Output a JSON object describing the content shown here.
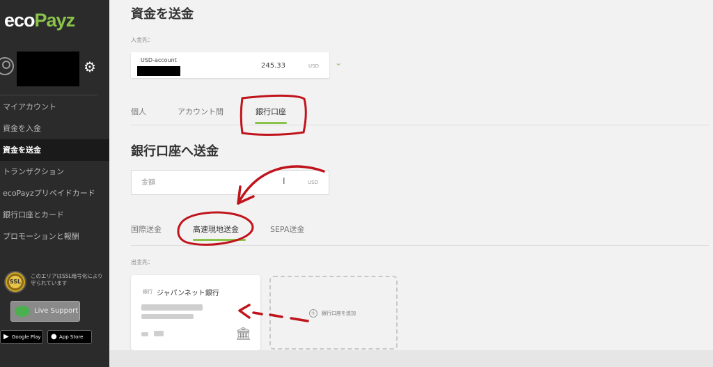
{
  "brand": {
    "logo_eco": "eco",
    "logo_payz": "Payz"
  },
  "sidebar": {
    "items": [
      {
        "label": "マイアカウント"
      },
      {
        "label": "資金を入金"
      },
      {
        "label": "資金を送金"
      },
      {
        "label": "トランザクション"
      },
      {
        "label": "ecoPayzプリペイドカード"
      },
      {
        "label": "銀行口座とカード"
      },
      {
        "label": "プロモーションと報酬"
      }
    ],
    "active_index": 2,
    "ssl_badge": "SSL",
    "ssl_text": "このエリアはSSL暗号化により守られています",
    "live_support": "Live Support",
    "google_play": "Google Play",
    "app_store": "App Store"
  },
  "main": {
    "title": "資金を送金",
    "deposit_label": "入金先：",
    "account": {
      "name": "USD-account",
      "balance": "245.33",
      "currency": "USD"
    },
    "tabs": [
      {
        "label": "個人"
      },
      {
        "label": "アカウント間"
      },
      {
        "label": "銀行口座"
      }
    ],
    "section_title": "銀行口座へ送金",
    "amount": {
      "placeholder": "金額",
      "value": "",
      "currency": "USD"
    },
    "transfer_tabs": [
      {
        "label": "国際送金"
      },
      {
        "label": "高速現地送金"
      },
      {
        "label": "SEPA送金"
      }
    ],
    "from_label": "出金先：",
    "bank_card": {
      "type": "銀行",
      "name": "ジャパンネット銀行"
    },
    "add_bank_label": "銀行口座を追加"
  },
  "colors": {
    "accent": "#8bc34a",
    "sidebar_bg": "#2b2b2b",
    "annotation": "#c0141c"
  },
  "icons": [
    "user-avatar-icon",
    "gear-icon",
    "chevron-down-icon",
    "text-cursor-icon",
    "bank-building-icon",
    "plus-circle-icon",
    "chat-bubble-icon",
    "google-play-icon",
    "apple-icon"
  ]
}
